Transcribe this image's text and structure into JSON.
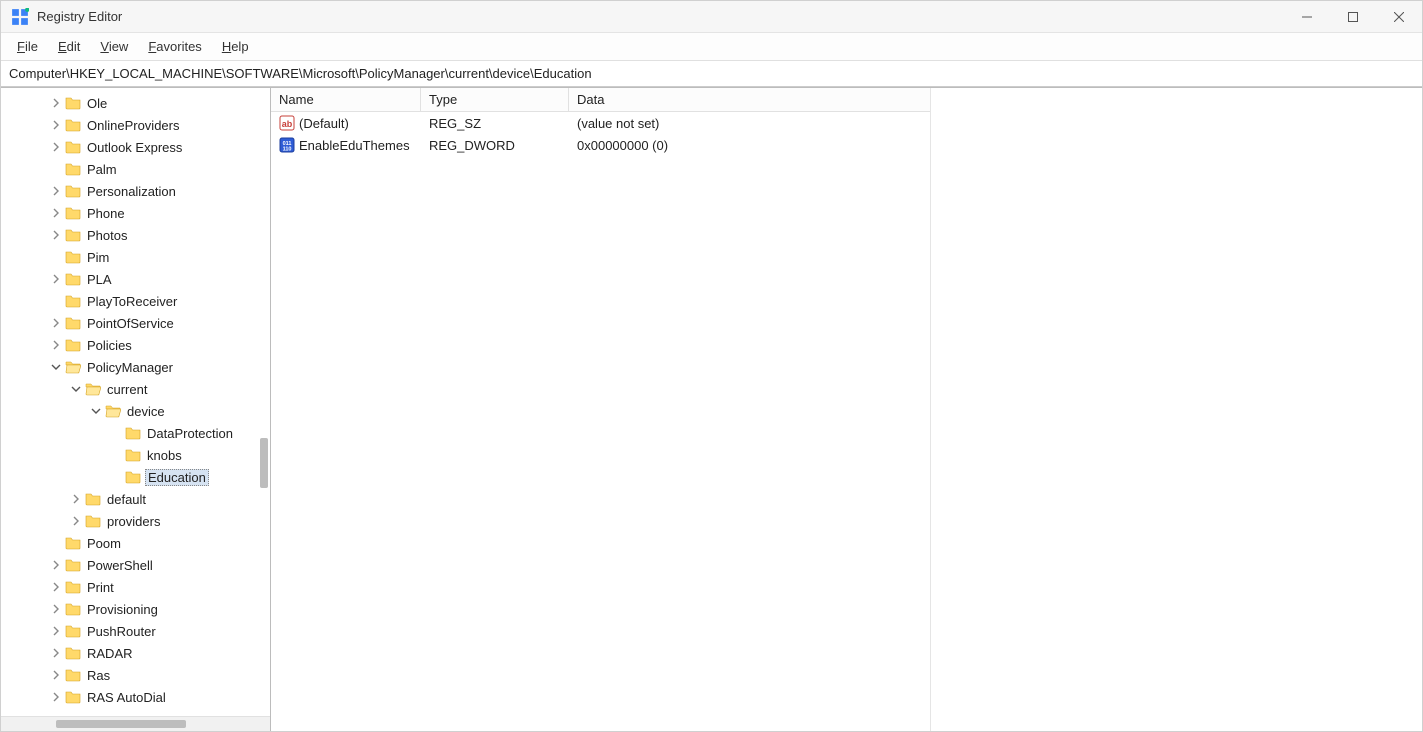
{
  "window": {
    "title": "Registry Editor"
  },
  "menubar": {
    "file": "File",
    "edit": "Edit",
    "view": "View",
    "favorites": "Favorites",
    "help": "Help"
  },
  "address": "Computer\\HKEY_LOCAL_MACHINE\\SOFTWARE\\Microsoft\\PolicyManager\\current\\device\\Education",
  "tree": [
    {
      "label": "Ole",
      "depth": 2,
      "expander": "closed"
    },
    {
      "label": "OnlineProviders",
      "depth": 2,
      "expander": "closed"
    },
    {
      "label": "Outlook Express",
      "depth": 2,
      "expander": "closed"
    },
    {
      "label": "Palm",
      "depth": 2,
      "expander": "none"
    },
    {
      "label": "Personalization",
      "depth": 2,
      "expander": "closed"
    },
    {
      "label": "Phone",
      "depth": 2,
      "expander": "closed"
    },
    {
      "label": "Photos",
      "depth": 2,
      "expander": "closed"
    },
    {
      "label": "Pim",
      "depth": 2,
      "expander": "none"
    },
    {
      "label": "PLA",
      "depth": 2,
      "expander": "closed"
    },
    {
      "label": "PlayToReceiver",
      "depth": 2,
      "expander": "none"
    },
    {
      "label": "PointOfService",
      "depth": 2,
      "expander": "closed"
    },
    {
      "label": "Policies",
      "depth": 2,
      "expander": "closed"
    },
    {
      "label": "PolicyManager",
      "depth": 2,
      "expander": "open"
    },
    {
      "label": "current",
      "depth": 3,
      "expander": "open"
    },
    {
      "label": "device",
      "depth": 4,
      "expander": "open"
    },
    {
      "label": "DataProtection",
      "depth": 5,
      "expander": "none"
    },
    {
      "label": "knobs",
      "depth": 5,
      "expander": "none"
    },
    {
      "label": "Education",
      "depth": 5,
      "expander": "none",
      "selected": true
    },
    {
      "label": "default",
      "depth": 3,
      "expander": "closed"
    },
    {
      "label": "providers",
      "depth": 3,
      "expander": "closed"
    },
    {
      "label": "Poom",
      "depth": 2,
      "expander": "none"
    },
    {
      "label": "PowerShell",
      "depth": 2,
      "expander": "closed"
    },
    {
      "label": "Print",
      "depth": 2,
      "expander": "closed"
    },
    {
      "label": "Provisioning",
      "depth": 2,
      "expander": "closed"
    },
    {
      "label": "PushRouter",
      "depth": 2,
      "expander": "closed"
    },
    {
      "label": "RADAR",
      "depth": 2,
      "expander": "closed"
    },
    {
      "label": "Ras",
      "depth": 2,
      "expander": "closed"
    },
    {
      "label": "RAS AutoDial",
      "depth": 2,
      "expander": "closed"
    }
  ],
  "columns": {
    "name": "Name",
    "type": "Type",
    "data": "Data"
  },
  "values": [
    {
      "name": "(Default)",
      "type": "REG_SZ",
      "data": "(value not set)",
      "icon": "string"
    },
    {
      "name": "EnableEduThemes",
      "type": "REG_DWORD",
      "data": "0x00000000 (0)",
      "icon": "binary"
    }
  ]
}
